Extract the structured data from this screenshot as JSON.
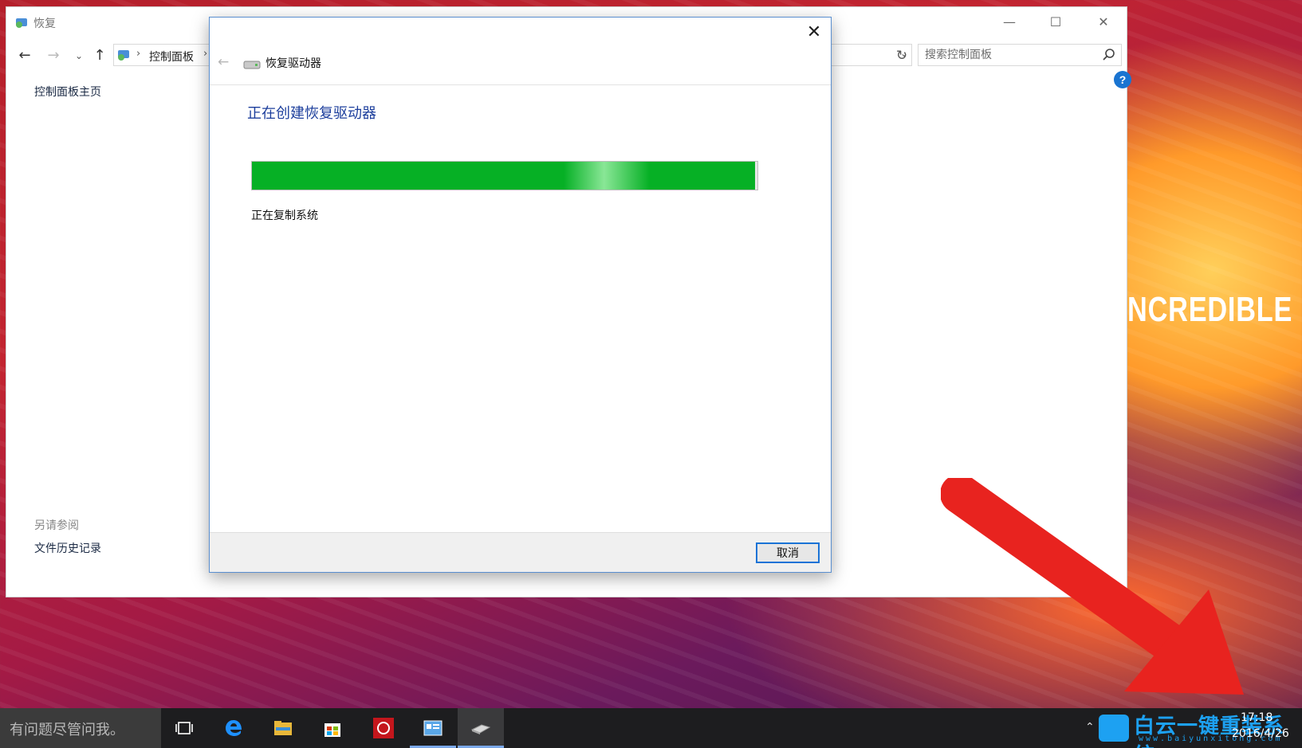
{
  "window": {
    "title": "恢复",
    "address_crumb": "控制面板",
    "search_placeholder": "搜索控制面板",
    "help_glyph": "?"
  },
  "sidebar": {
    "home_link": "控制面板主页",
    "see_also_heading": "另请参阅",
    "file_history_link": "文件历史记录"
  },
  "dialog": {
    "title": "恢复驱动器",
    "heading": "正在创建恢复驱动器",
    "status": "正在复制系统",
    "progress": 0.995,
    "cancel_label": "取消"
  },
  "wallpaper": {
    "text": "NCREDIBLE"
  },
  "taskbar": {
    "search_text": "有问题尽管问我。",
    "items": [
      "task-view-icon",
      "edge-icon",
      "file-explorer-icon",
      "store-icon",
      "red-app-icon",
      "control-panel-icon",
      "recovery-drive-icon"
    ],
    "clock_time": "17:18",
    "clock_date": "2016/4/26"
  },
  "watermark": {
    "brand": "白云一键重装系统",
    "url": "www.baiyunxitong.com"
  },
  "colors": {
    "progress_green": "#06b025",
    "heading_blue": "#1c3e9c",
    "arrow_red": "#e8231f",
    "watermark_blue": "#1da1f2"
  }
}
